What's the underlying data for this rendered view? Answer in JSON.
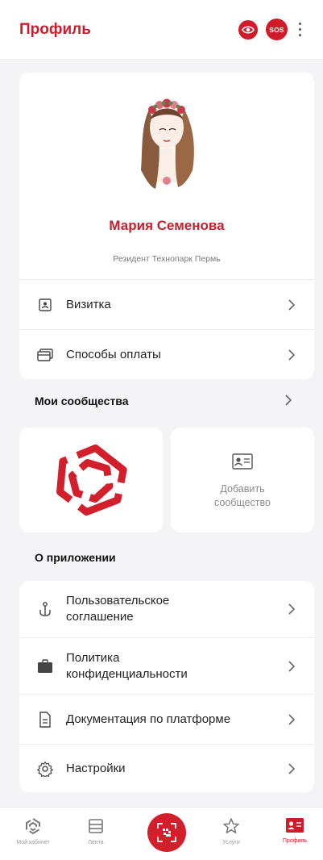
{
  "header": {
    "title": "Профиль",
    "sos_label": "SOS"
  },
  "profile": {
    "name": "Мария Семенова",
    "role": "Резидент Технопарк Пермь",
    "menu": [
      {
        "label": "Визитка",
        "icon": "id-card-icon"
      },
      {
        "label": "Способы оплаты",
        "icon": "payment-cards-icon"
      }
    ]
  },
  "communities": {
    "title": "Мои сообщества",
    "add_label": "Добавить сообщество"
  },
  "about": {
    "title": "О приложении",
    "items": [
      {
        "label": "Пользовательское соглашение",
        "icon": "anchor-icon"
      },
      {
        "label": "Политика конфиденциальности",
        "icon": "briefcase-icon"
      },
      {
        "label": "Документация по платформе",
        "icon": "document-icon"
      },
      {
        "label": "Настройки",
        "icon": "gear-icon"
      }
    ]
  },
  "nav": {
    "tabs": [
      {
        "label": "Мой кабинет",
        "icon": "logo-icon"
      },
      {
        "label": "Лента",
        "icon": "feed-icon"
      },
      {
        "label": "Услуги",
        "icon": "star-icon"
      },
      {
        "label": "Профиль",
        "icon": "profile-card-icon",
        "active": true
      }
    ]
  },
  "colors": {
    "accent": "#d01c2a",
    "background": "#f4f4f6"
  }
}
